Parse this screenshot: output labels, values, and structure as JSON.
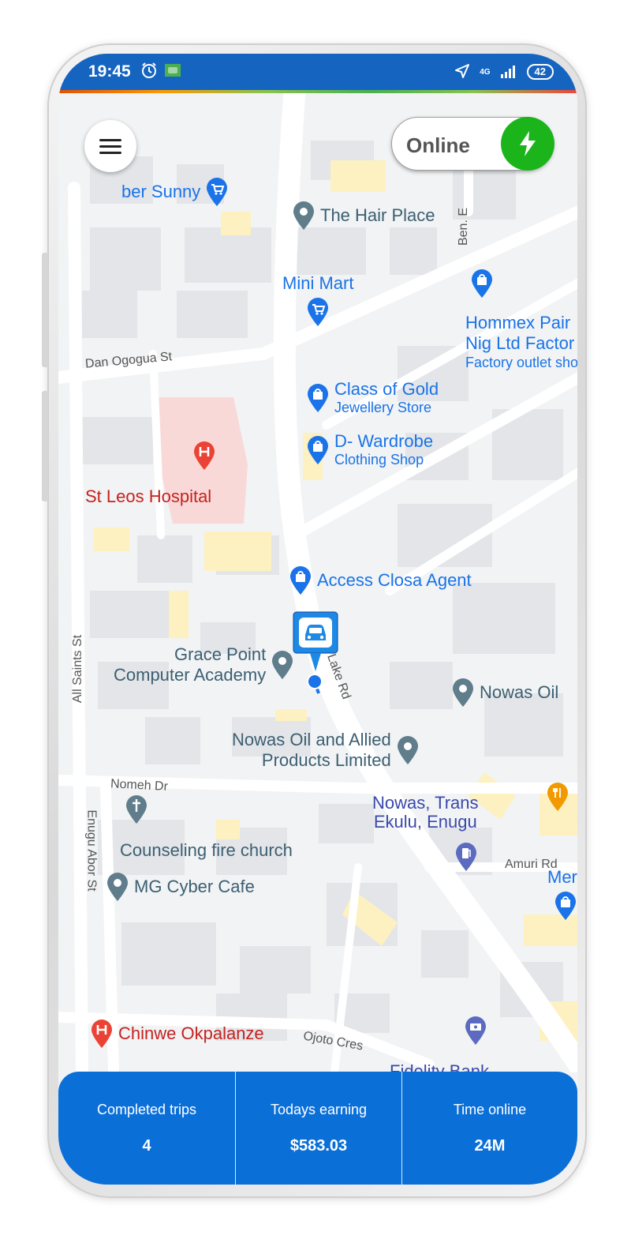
{
  "status_bar": {
    "time": "19:45",
    "network": "4G",
    "battery": "42"
  },
  "top_controls": {
    "online_label": "Online"
  },
  "map": {
    "places": {
      "cyber_sunny": "ber Sunny",
      "hair_place": "The Hair Place",
      "mini_mart": "Mini Mart",
      "hommex_line1": "Hommex Pair",
      "hommex_line2": "Nig Ltd Factor",
      "hommex_sub": "Factory outlet sho",
      "class_of_gold": "Class of Gold",
      "class_of_gold_sub": "Jewellery Store",
      "d_wardrobe": "D- Wardrobe",
      "d_wardrobe_sub": "Clothing Shop",
      "st_leos": "St Leos Hospital",
      "access_closa": "Access Closa Agent",
      "grace_point_1": "Grace Point",
      "grace_point_2": "Computer Academy",
      "nowas_oil": "Nowas Oil",
      "nowas_allied_1": "Nowas Oil and Allied",
      "nowas_allied_2": "Products Limited",
      "nowas_trans_1": "Nowas, Trans",
      "nowas_trans_2": "Ekulu, Enugu",
      "counseling": "Counseling fire church",
      "mg_cyber": "MG Cyber Cafe",
      "chinwe": "Chinwe Okpalanze",
      "fidelity": "Fidelity Bank",
      "mer": "Mer"
    },
    "roads": {
      "dan_ogogua": "Dan Ogogua St",
      "lake_rd": "Lake Rd",
      "all_saints": "All Saints St",
      "nomeh": "Nomeh Dr",
      "enugu_abor": "Enugu Abor St",
      "amuri": "Amuri Rd",
      "ojoto": "Ojoto Cres",
      "ben_e": "Ben. E"
    }
  },
  "stats": [
    {
      "title": "Completed trips",
      "value": "4"
    },
    {
      "title": "Todays earning",
      "value": "$583.03"
    },
    {
      "title": "Time online",
      "value": "24M"
    }
  ],
  "colors": {
    "accent": "#0b6fd8",
    "status_bar": "#1565c0",
    "online_green": "#1bb51b"
  },
  "icons": [
    "alarm-icon",
    "android-icon",
    "location-arrow-icon",
    "signal-icon",
    "menu-icon",
    "lightning-icon",
    "car-icon",
    "shopping-cart-icon",
    "shopping-bag-icon",
    "hospital-icon",
    "church-icon",
    "fuel-icon",
    "bank-icon",
    "restaurant-icon",
    "map-pin-icon"
  ]
}
